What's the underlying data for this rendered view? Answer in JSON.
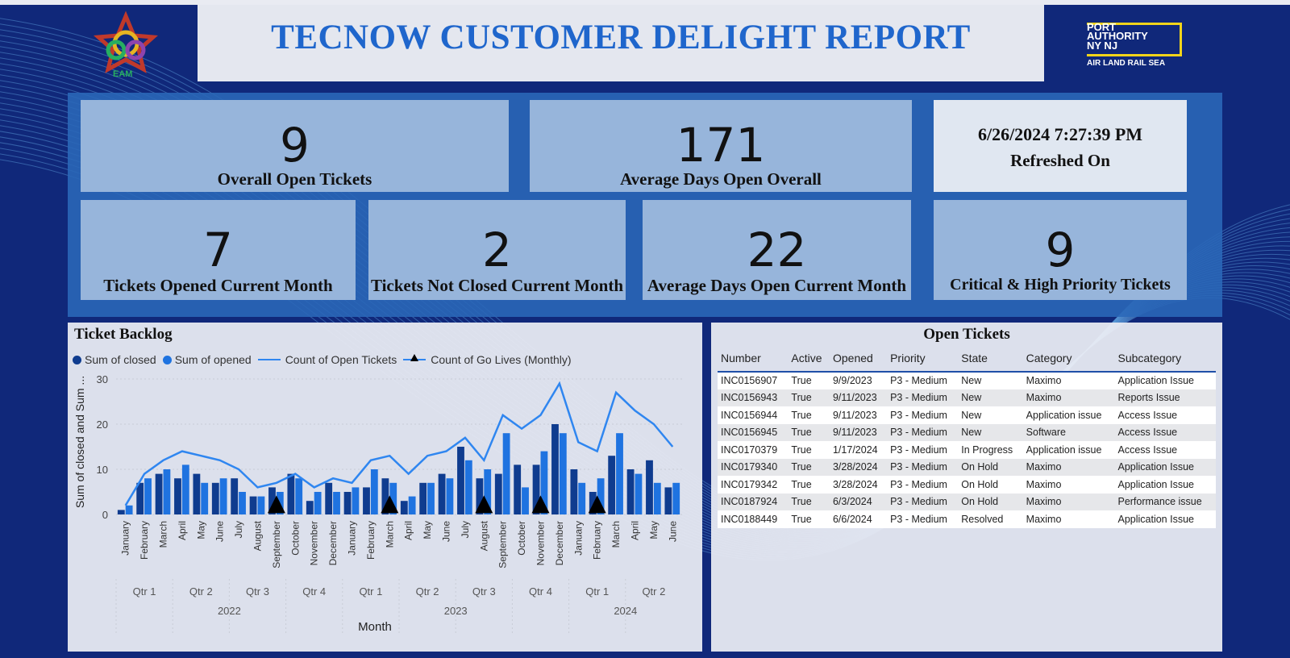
{
  "header": {
    "title": "TECNOW CUSTOMER DELIGHT REPORT",
    "left_logo": {
      "icon": "knot-star-logo-icon",
      "text": "EAM"
    },
    "right_logo": {
      "lines": [
        "PORT",
        "AUTHORITY",
        "NY NJ"
      ],
      "tagline": "AIR LAND RAIL SEA",
      "accent": "#f2d41a"
    }
  },
  "kpis": {
    "overall_open": {
      "value": "9",
      "label": "Overall Open Tickets"
    },
    "avg_days_overall": {
      "value": "171",
      "label": "Average Days Open Overall"
    },
    "refreshed": {
      "value": "6/26/2024 7:27:39 PM",
      "label": "Refreshed On"
    },
    "opened_current_month": {
      "value": "7",
      "label": "Tickets Opened Current Month"
    },
    "not_closed_current_month": {
      "value": "2",
      "label": "Tickets Not Closed Current Month"
    },
    "avg_days_current_month": {
      "value": "22",
      "label": "Average Days Open Current Month"
    },
    "critical_high": {
      "value": "9",
      "label": "Critical & High Priority Tickets"
    }
  },
  "backlog": {
    "title": "Ticket Backlog",
    "legend": [
      "Sum of closed",
      "Sum of opened",
      "Count of Open Tickets",
      "Count of Go Lives (Monthly)"
    ]
  },
  "chart_data": {
    "type": "bar",
    "xlabel": "Month",
    "ylabel": "Sum of closed and Sum ...",
    "ylim": [
      0,
      30
    ],
    "yticks": [
      0,
      10,
      20,
      30
    ],
    "grid": true,
    "legend_position": "top-left",
    "categories": [
      "January",
      "February",
      "March",
      "April",
      "May",
      "June",
      "July",
      "August",
      "September",
      "October",
      "November",
      "December",
      "January",
      "February",
      "March",
      "April",
      "May",
      "June",
      "July",
      "August",
      "September",
      "October",
      "November",
      "December",
      "January",
      "February",
      "March",
      "April",
      "May",
      "June"
    ],
    "quarters": [
      {
        "label": "Qtr 1"
      },
      {
        "label": "Qtr 2"
      },
      {
        "label": "Qtr 3"
      },
      {
        "label": "Qtr 4"
      },
      {
        "label": "Qtr 1"
      },
      {
        "label": "Qtr 2"
      },
      {
        "label": "Qtr 3"
      },
      {
        "label": "Qtr 4"
      },
      {
        "label": "Qtr 1"
      },
      {
        "label": "Qtr 2"
      }
    ],
    "years": [
      {
        "label": "2022",
        "months": 12
      },
      {
        "label": "2023",
        "months": 12
      },
      {
        "label": "2024",
        "months": 6
      }
    ],
    "series": [
      {
        "name": "Sum of closed",
        "kind": "bar",
        "color": "#0f3c8f",
        "values": [
          1,
          7,
          9,
          8,
          9,
          7,
          8,
          4,
          6,
          9,
          3,
          7,
          5,
          6,
          8,
          3,
          7,
          9,
          15,
          8,
          9,
          11,
          11,
          20,
          10,
          5,
          13,
          10,
          12,
          6
        ]
      },
      {
        "name": "Sum of opened",
        "kind": "bar",
        "color": "#1f73e0",
        "values": [
          2,
          8,
          10,
          11,
          7,
          8,
          5,
          4,
          5,
          8,
          5,
          5,
          6,
          10,
          7,
          4,
          7,
          8,
          12,
          10,
          18,
          6,
          14,
          18,
          7,
          8,
          18,
          9,
          7,
          7
        ]
      },
      {
        "name": "Count of Open Tickets",
        "kind": "line",
        "color": "#2f86f0",
        "values": [
          2,
          9,
          12,
          14,
          13,
          12,
          10,
          6,
          7,
          9,
          6,
          8,
          7,
          12,
          13,
          9,
          13,
          14,
          17,
          12,
          22,
          19,
          22,
          29,
          16,
          14,
          27,
          23,
          20,
          15
        ]
      },
      {
        "name": "Count of Go Lives (Monthly)",
        "kind": "marker",
        "color": "#000000",
        "values": [
          0,
          0,
          0,
          0,
          0,
          0,
          0,
          0,
          1,
          0,
          0,
          0,
          0,
          0,
          1,
          0,
          0,
          0,
          0,
          1,
          0,
          0,
          1,
          0,
          0,
          1,
          0,
          0,
          0,
          0
        ]
      }
    ]
  },
  "open_tickets": {
    "title": "Open Tickets",
    "columns": [
      "Number",
      "Active",
      "Opened",
      "Priority",
      "State",
      "Category",
      "Subcategory"
    ],
    "rows": [
      [
        "INC0156907",
        "True",
        "9/9/2023",
        "P3 - Medium",
        "New",
        "Maximo",
        "Application Issue"
      ],
      [
        "INC0156943",
        "True",
        "9/11/2023",
        "P3 - Medium",
        "New",
        "Maximo",
        "Reports Issue"
      ],
      [
        "INC0156944",
        "True",
        "9/11/2023",
        "P3 - Medium",
        "New",
        "Application issue",
        "Access Issue"
      ],
      [
        "INC0156945",
        "True",
        "9/11/2023",
        "P3 - Medium",
        "New",
        "Software",
        "Access Issue"
      ],
      [
        "INC0170379",
        "True",
        "1/17/2024",
        "P3 - Medium",
        "In Progress",
        "Application issue",
        "Access Issue"
      ],
      [
        "INC0179340",
        "True",
        "3/28/2024",
        "P3 - Medium",
        "On Hold",
        "Maximo",
        "Application Issue"
      ],
      [
        "INC0179342",
        "True",
        "3/28/2024",
        "P3 - Medium",
        "On Hold",
        "Maximo",
        "Application Issue"
      ],
      [
        "INC0187924",
        "True",
        "6/3/2024",
        "P3 - Medium",
        "On Hold",
        "Maximo",
        "Performance issue"
      ],
      [
        "INC0188449",
        "True",
        "6/6/2024",
        "P3 - Medium",
        "Resolved",
        "Maximo",
        "Application Issue"
      ]
    ]
  }
}
